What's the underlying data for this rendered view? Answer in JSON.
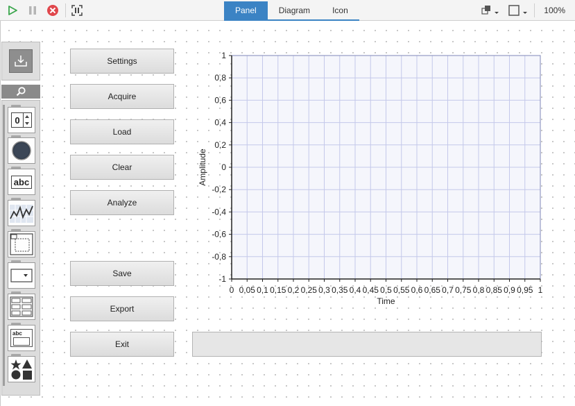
{
  "toolbar": {
    "run_icon": "play-icon",
    "pause_icon": "pause-icon",
    "stop_icon": "stop-icon",
    "debug_icon": "highlight-icon",
    "tabs": [
      {
        "label": "Panel",
        "active": true
      },
      {
        "label": "Diagram",
        "active": false
      },
      {
        "label": "Icon",
        "active": false
      }
    ],
    "zoom": "100%",
    "accent_color": "#3b83c4"
  },
  "palette": {
    "items": [
      {
        "name": "numeric-control",
        "label": "0"
      },
      {
        "name": "boolean-led"
      },
      {
        "name": "string-control",
        "label": "abc"
      },
      {
        "name": "graph-control"
      },
      {
        "name": "container-control"
      },
      {
        "name": "ring-control"
      },
      {
        "name": "list-control"
      },
      {
        "name": "string-indicator",
        "label": "abc"
      },
      {
        "name": "decorations"
      }
    ]
  },
  "buttons": [
    "Settings",
    "Acquire",
    "Load",
    "Clear",
    "Analyze",
    "Save",
    "Export",
    "Exit"
  ],
  "chart_data": {
    "type": "line",
    "title": "",
    "xlabel": "Time",
    "ylabel": "Amplitude",
    "xlim": [
      0,
      1
    ],
    "ylim": [
      -1,
      1
    ],
    "x_ticks": [
      "0",
      "0,05",
      "0,1",
      "0,15",
      "0,2",
      "0,25",
      "0,3",
      "0,35",
      "0,4",
      "0,45",
      "0,5",
      "0,55",
      "0,6",
      "0,65",
      "0,7",
      "0,75",
      "0,8",
      "0,85",
      "0,9",
      "0,95",
      "1"
    ],
    "y_ticks": [
      "1",
      "0,8",
      "0,6",
      "0,4",
      "0,2",
      "0",
      "-0,2",
      "-0,4",
      "-0,6",
      "-0,8",
      "-1"
    ],
    "grid": true,
    "series": []
  }
}
